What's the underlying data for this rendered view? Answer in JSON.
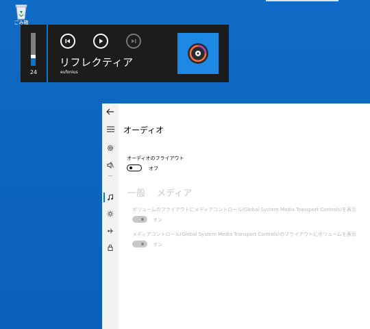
{
  "desktop": {
    "recycle_bin_label": "ごみ箱"
  },
  "flyout": {
    "volume_value": "24",
    "volume_level_percent": 24,
    "track_title": "リフレクティア",
    "artist": "eufonius",
    "controls": [
      "previous-icon",
      "play-icon",
      "next-icon"
    ],
    "accent_color": "#0078d7",
    "album_art_color": "#1e88e5"
  },
  "settings": {
    "page_title": "オーディオ",
    "audio_flyout": {
      "label": "オーディオのフライアウト",
      "state": "オフ"
    },
    "tabs": [
      "一般",
      "メディア"
    ],
    "options": [
      {
        "label": "ボリュームのフライアウトにメディアコントロール(Global System Media Transport Controls)を表示",
        "state": "オン"
      },
      {
        "label": "メディアコントロール(Global System Media Transport Controls)のフライアウトにボリュームを表示",
        "state": "オン"
      }
    ],
    "rail_icons": [
      "back-arrow-icon",
      "hamburger-menu-icon",
      "gear-icon",
      "speaker-icon",
      "music-note-icon",
      "brightness-icon",
      "airplane-icon",
      "lock-icon"
    ]
  }
}
